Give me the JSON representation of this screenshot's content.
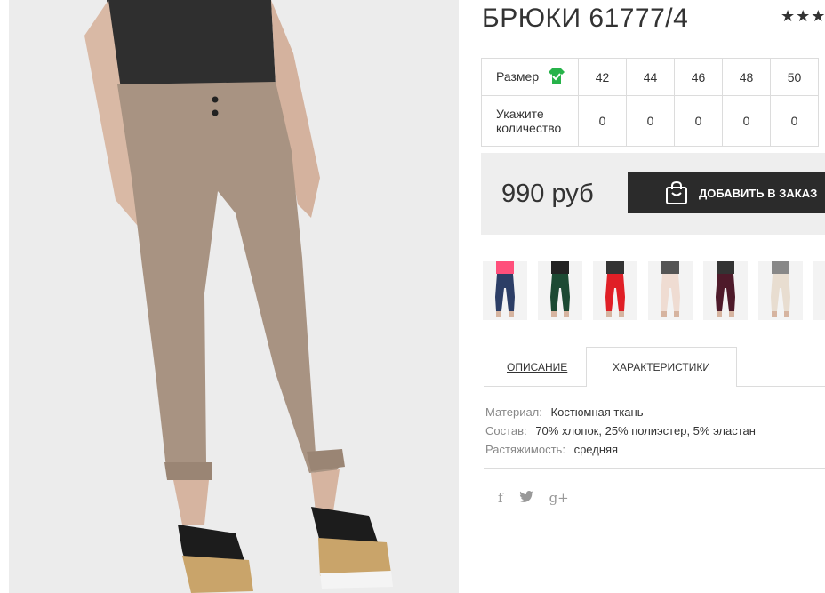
{
  "product": {
    "title": "БРЮКИ 61777/4",
    "rating_stars": "★★★"
  },
  "sizes": {
    "size_label": "Размер",
    "qty_label_line1": "Укажите",
    "qty_label_line2": "количество",
    "values": [
      "42",
      "44",
      "46",
      "48",
      "50"
    ],
    "quantities": [
      "0",
      "0",
      "0",
      "0",
      "0"
    ]
  },
  "purchase": {
    "price": "990 руб",
    "order_button": "ДОБАВИТЬ В ЗАКАЗ"
  },
  "thumbnails": [
    {
      "name": "navy",
      "pants": "#2c3e66",
      "top": "#ff4f7b"
    },
    {
      "name": "green",
      "pants": "#1c4a33",
      "top": "#222222"
    },
    {
      "name": "red",
      "pants": "#e01f26",
      "top": "#333333"
    },
    {
      "name": "light-pink",
      "pants": "#efdcd2",
      "top": "#555555"
    },
    {
      "name": "burgundy",
      "pants": "#4e1a2a",
      "top": "#333333"
    },
    {
      "name": "beige",
      "pants": "#e8ddd0",
      "top": "#888888"
    },
    {
      "name": "white",
      "pants": "#f0ece6",
      "top": "#333333"
    }
  ],
  "tabs": {
    "description": "ОПИСАНИЕ",
    "characteristics": "ХАРАКТЕРИСТИКИ"
  },
  "specs": [
    {
      "key": "Материал:",
      "value": "Костюмная ткань"
    },
    {
      "key": "Состав:",
      "value": "70% хлопок, 25% полиэстер, 5% эластан"
    },
    {
      "key": "Растяжимость:",
      "value": "средняя"
    }
  ],
  "social": {
    "facebook": "f",
    "twitter": "🐦",
    "google_plus": "g+"
  },
  "colors": {
    "button_bg": "#2b2b2b",
    "price_bg": "#eeeeee",
    "size_icon": "#27b34a",
    "main_pants": "#a89382"
  }
}
